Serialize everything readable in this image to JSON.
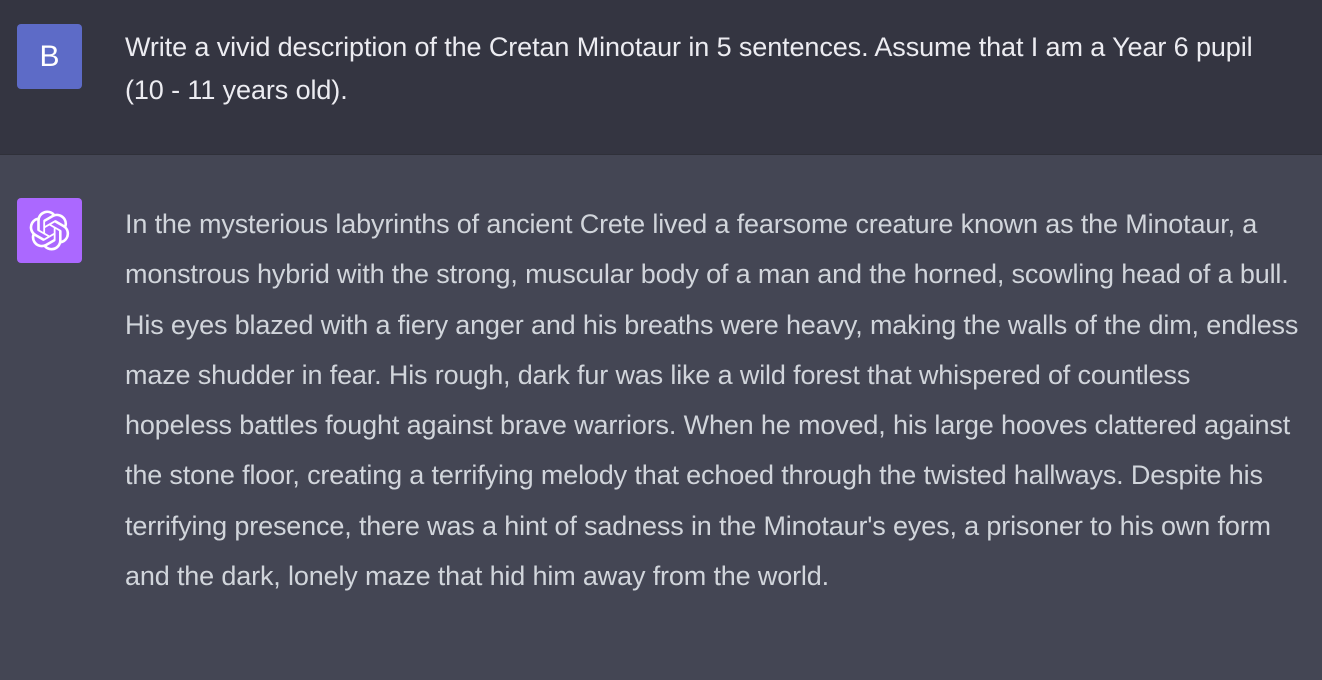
{
  "user_message": {
    "avatar_letter": "B",
    "avatar_color": "#5d6bc7",
    "text": "Write a vivid description of the Cretan Minotaur in 5 sentences. Assume that I am a Year 6 pupil (10 - 11 years old)."
  },
  "assistant_message": {
    "avatar_icon": "openai-logo-icon",
    "avatar_color": "#ab68ff",
    "text": "In the mysterious labyrinths of ancient Crete lived a fearsome creature known as the Minotaur, a monstrous hybrid with the strong, muscular body of a man and the horned, scowling head of a bull. His eyes blazed with a fiery anger and his breaths were heavy, making the walls of the dim, endless maze shudder in fear. His rough, dark fur was like a wild forest that whispered of countless hopeless battles fought against brave warriors. When he moved, his large hooves clattered against the stone floor, creating a terrifying melody that echoed through the twisted hallways. Despite his terrifying presence, there was a hint of sadness in the Minotaur's eyes, a prisoner to his own form and the dark, lonely maze that hid him away from the world."
  },
  "colors": {
    "user_background": "#343541",
    "assistant_background": "#444654",
    "user_text": "#ececf1",
    "assistant_text": "#d1d5db"
  }
}
